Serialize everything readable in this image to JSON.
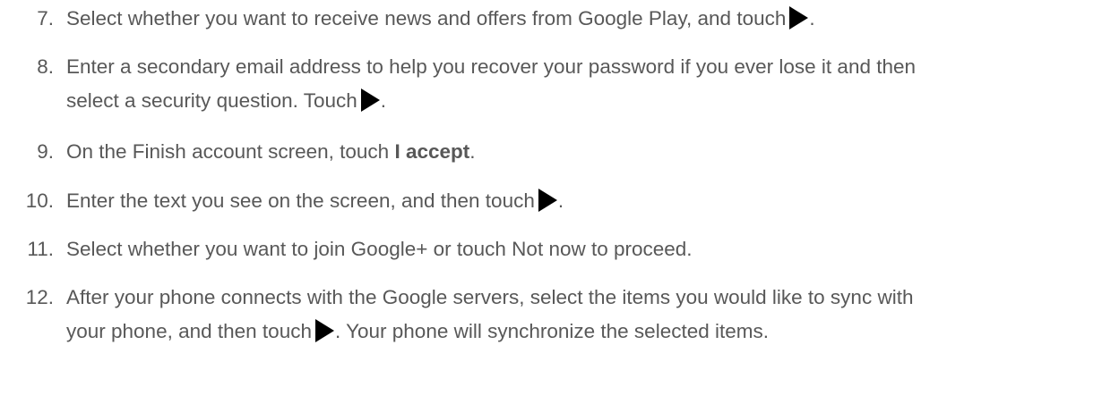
{
  "steps": [
    {
      "number": "7.",
      "text_before": "Select whether you want to receive news and offers from Google Play, and touch",
      "icon": "next-arrow-icon",
      "text_after": "."
    },
    {
      "number": "8.",
      "line1": "Enter a secondary email address to help you recover your password if you ever lose it and then",
      "line2_before": "select a security question. Touch",
      "icon": "next-arrow-icon",
      "line2_after": "."
    },
    {
      "number": "9.",
      "text_before": "On the Finish account screen, touch ",
      "bold": "I accept",
      "text_after": "."
    },
    {
      "number": "10.",
      "text_before": "Enter the text you see on the screen, and then touch",
      "icon": "next-arrow-icon",
      "text_after": "."
    },
    {
      "number": "11.",
      "text": "Select whether you want to join Google+ or touch Not now to proceed."
    },
    {
      "number": "12.",
      "line1": "After your phone connects with the Google servers, select the items you would like to sync with",
      "line2_before": "your phone, and then touch",
      "icon": "next-arrow-icon",
      "line2_after": ". Your phone will synchronize the selected items."
    }
  ]
}
